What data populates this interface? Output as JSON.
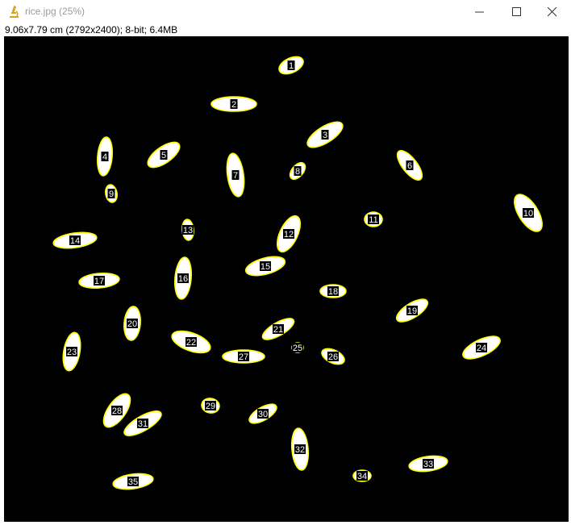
{
  "window": {
    "title": "rice.jpg (25%)",
    "app_icon": "microscope-icon",
    "controls": [
      "minimize-icon",
      "maximize-icon",
      "close-icon"
    ]
  },
  "image_info": {
    "text": "9.06x7.79 cm (2792x2400); 8-bit; 6.4MB"
  },
  "overlay": {
    "grain_fill": "#ffffff",
    "outline_color": "#ffff00",
    "label_bg": "#000000",
    "label_text": "#ffffff",
    "background": "#000000"
  },
  "grains": [
    {
      "label": "1"
    },
    {
      "label": "2"
    },
    {
      "label": "3"
    },
    {
      "label": "4"
    },
    {
      "label": "5"
    },
    {
      "label": "6"
    },
    {
      "label": "7"
    },
    {
      "label": "8"
    },
    {
      "label": "9"
    },
    {
      "label": "10"
    },
    {
      "label": "11"
    },
    {
      "label": "12"
    },
    {
      "label": "13"
    },
    {
      "label": "14"
    },
    {
      "label": "15"
    },
    {
      "label": "16"
    },
    {
      "label": "17"
    },
    {
      "label": "18"
    },
    {
      "label": "19"
    },
    {
      "label": "20"
    },
    {
      "label": "21"
    },
    {
      "label": "22"
    },
    {
      "label": "23"
    },
    {
      "label": "24"
    },
    {
      "label": "25"
    },
    {
      "label": "26"
    },
    {
      "label": "27"
    },
    {
      "label": "28"
    },
    {
      "label": "29"
    },
    {
      "label": "30"
    },
    {
      "label": "31"
    },
    {
      "label": "32"
    },
    {
      "label": "33"
    },
    {
      "label": "34"
    },
    {
      "label": "35"
    }
  ]
}
